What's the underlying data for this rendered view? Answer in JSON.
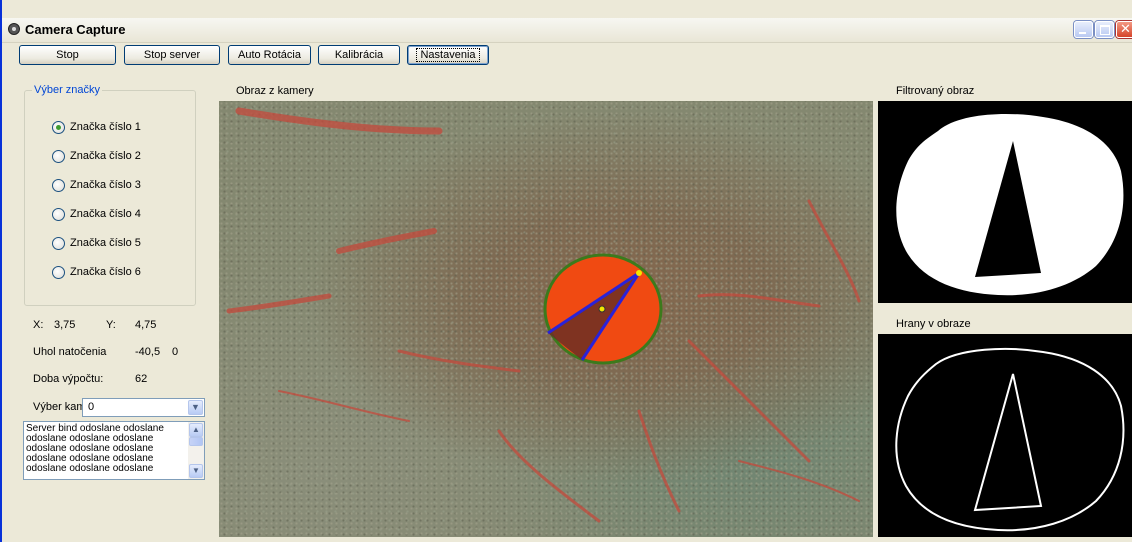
{
  "window": {
    "title": "Camera Capture"
  },
  "toolbar": {
    "stop_label": "Stop",
    "stop_server_label": "Stop server",
    "auto_rotation_label": "Auto Rotácia",
    "calibration_label": "Kalibrácia",
    "settings_label": "Nastavenia"
  },
  "marker_group": {
    "title": "Výber značky",
    "options": [
      {
        "label": "Značka číslo 1",
        "checked": true
      },
      {
        "label": "Značka číslo 2",
        "checked": false
      },
      {
        "label": "Značka číslo 3",
        "checked": false
      },
      {
        "label": "Značka číslo 4",
        "checked": false
      },
      {
        "label": "Značka číslo 5",
        "checked": false
      },
      {
        "label": "Značka číslo 6",
        "checked": false
      }
    ]
  },
  "readouts": {
    "x_label": "X:",
    "x_value": "3,75",
    "y_label": "Y:",
    "y_value": "4,75",
    "angle_label": "Uhol natočenia",
    "angle_value": "-40,5",
    "angle_extra": "0",
    "compute_time_label": "Doba výpočtu:",
    "compute_time_value": "62",
    "camera_select_label": "Výber kamery",
    "camera_select_value": "0"
  },
  "log": {
    "text": "Server bind odoslane odoslane\nodoslane odoslane odoslane\nodoslane odoslane odoslane\nodoslane odoslane odoslane\nodoslane odoslane odoslane"
  },
  "panels": {
    "camera_label": "Obraz z kamery",
    "filtered_label": "Filtrovaný obraz",
    "edges_label": "Hrany v obraze"
  },
  "colors": {
    "accent": "#0046d5",
    "marker_fill": "#f04a12",
    "marker_ring": "#3c7a1c",
    "marker_line": "#2a22d8",
    "center_dot": "#f2e600"
  }
}
